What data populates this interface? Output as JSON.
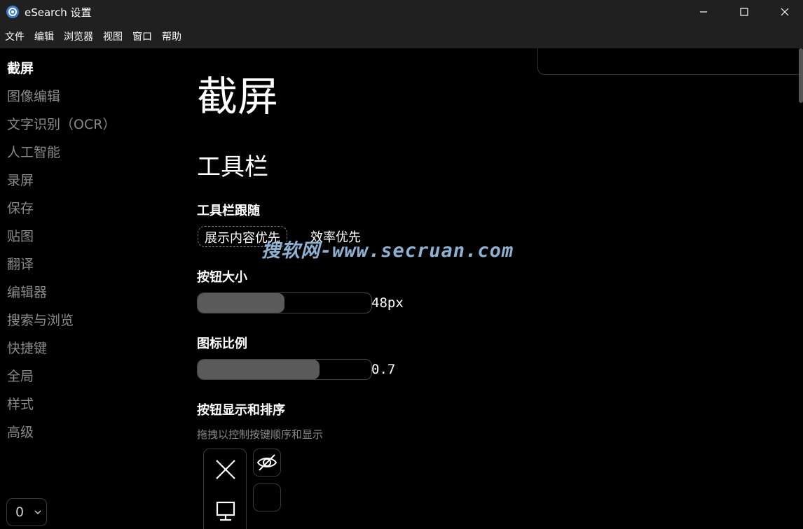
{
  "window": {
    "title": "eSearch 设置"
  },
  "menubar": {
    "items": [
      "文件",
      "编辑",
      "浏览器",
      "视图",
      "窗口",
      "帮助"
    ]
  },
  "sidebar": {
    "items": [
      {
        "label": "截屏",
        "active": true
      },
      {
        "label": "图像编辑"
      },
      {
        "label": "文字识别（OCR）"
      },
      {
        "label": "人工智能"
      },
      {
        "label": "录屏"
      },
      {
        "label": "保存"
      },
      {
        "label": "贴图"
      },
      {
        "label": "翻译"
      },
      {
        "label": "编辑器"
      },
      {
        "label": "搜索与浏览"
      },
      {
        "label": "快捷键"
      },
      {
        "label": "全局"
      },
      {
        "label": "样式"
      },
      {
        "label": "高级"
      }
    ],
    "version_select": {
      "value": "0"
    }
  },
  "main": {
    "page_title": "截屏",
    "section_title": "工具栏",
    "toolbar_follow": {
      "label": "工具栏跟随",
      "options": [
        "展示内容优先",
        "效率优先"
      ],
      "selected": "展示内容优先"
    },
    "button_size": {
      "label": "按钮大小",
      "value_text": "48px",
      "fill_fraction": 0.5
    },
    "icon_scale": {
      "label": "图标比例",
      "value_text": "0.7",
      "fill_fraction": 0.7
    },
    "button_order": {
      "label": "按钮显示和排序",
      "hint": "拖拽以控制按键顺序和显示",
      "visible_buttons": [
        "close-icon",
        "pin-screen-icon"
      ],
      "hidden_zone_icons": [
        "eye-off-icon"
      ]
    }
  },
  "watermark": "搜软网-www.secruan.com"
}
